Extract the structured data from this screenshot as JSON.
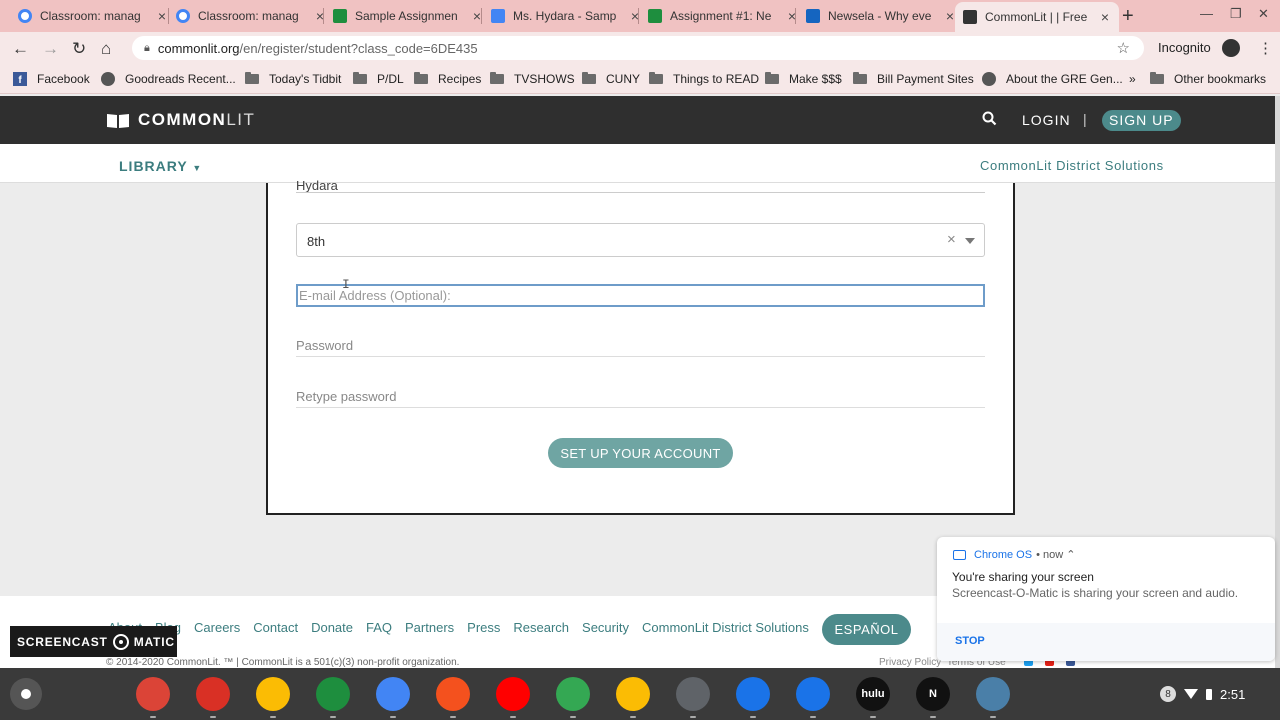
{
  "browser": {
    "tabs": [
      {
        "title": "Classroom: manag",
        "icon": "google-g-icon",
        "color": "#4285f4"
      },
      {
        "title": "Classroom: manag",
        "icon": "google-g-icon",
        "color": "#4285f4"
      },
      {
        "title": "Sample Assignmen",
        "icon": "google-classroom-icon",
        "color": "#1e8e3e"
      },
      {
        "title": "Ms. Hydara - Samp",
        "icon": "google-docs-icon",
        "color": "#4285f4"
      },
      {
        "title": "Assignment #1: Ne",
        "icon": "google-classroom-icon",
        "color": "#1e8e3e"
      },
      {
        "title": "Newsela - Why eve",
        "icon": "newsela-icon",
        "color": "#1565c0"
      },
      {
        "title": "CommonLit | | Free",
        "icon": "commonlit-book-icon",
        "color": "#333333"
      }
    ],
    "url_host": "commonlit.org",
    "url_path": "/en/register/student?class_code=6DE435",
    "incognito_label": "Incognito",
    "bookmarks": [
      {
        "label": "Facebook",
        "icon": "facebook-icon"
      },
      {
        "label": "Goodreads Recent...",
        "icon": "globe-icon"
      },
      {
        "label": "Today's Tidbit",
        "icon": "folder-icon"
      },
      {
        "label": "P/DL",
        "icon": "folder-icon"
      },
      {
        "label": "Recipes",
        "icon": "folder-icon"
      },
      {
        "label": "TVSHOWS",
        "icon": "folder-icon"
      },
      {
        "label": "CUNY",
        "icon": "folder-icon"
      },
      {
        "label": "Things to READ",
        "icon": "folder-icon"
      },
      {
        "label": "Make $$$",
        "icon": "folder-icon"
      },
      {
        "label": "Bill Payment Sites",
        "icon": "folder-icon"
      },
      {
        "label": "About the GRE Gen...",
        "icon": "globe-icon"
      }
    ],
    "bookmarks_overflow": "»",
    "other_bookmarks": "Other bookmarks"
  },
  "site": {
    "brand_common": "COMMON",
    "brand_lit": "LIT",
    "login": "LOGIN",
    "separator": "|",
    "signup": "SIGN UP",
    "library": "LIBRARY",
    "district": "CommonLit District Solutions"
  },
  "form": {
    "last_name_value": "Hydara",
    "grade_value": "8th",
    "grade_clear": "×",
    "email_placeholder": "E-mail Address (Optional):",
    "password_placeholder": "Password",
    "retype_placeholder": "Retype password",
    "submit_label": "SET UP YOUR ACCOUNT"
  },
  "footer": {
    "links": [
      "About",
      "Blog",
      "Careers",
      "Contact",
      "Donate",
      "FAQ",
      "Partners",
      "Press",
      "Research",
      "Security",
      "CommonLit District Solutions"
    ],
    "espanol": "ESPAÑOL",
    "copyright": "© 2014-2020 CommonLit. ™ | CommonLit is a 501(c)(3) non-profit organization.",
    "privacy": "Privacy Policy",
    "terms": "Terms of Use"
  },
  "screencast_badge": {
    "left": "SCREENCAST",
    "right": "MATIC"
  },
  "notification": {
    "app": "Chrome OS",
    "time": "now",
    "title": "You're sharing your screen",
    "body": "Screencast-O-Matic is sharing your screen and audio.",
    "stop": "STOP"
  },
  "shelf": {
    "apps": [
      {
        "name": "chrome-icon",
        "color": "#db4437",
        "label": ""
      },
      {
        "name": "gmail-icon",
        "color": "#d93025",
        "label": ""
      },
      {
        "name": "keep-icon",
        "color": "#fbbc04",
        "label": ""
      },
      {
        "name": "drive-icon",
        "color": "#1e8e3e",
        "label": ""
      },
      {
        "name": "docs-icon",
        "color": "#4285f4",
        "label": ""
      },
      {
        "name": "play-movies-icon",
        "color": "#f4511e",
        "label": ""
      },
      {
        "name": "youtube-icon",
        "color": "#ff0000",
        "label": ""
      },
      {
        "name": "play-store-icon",
        "color": "#34a853",
        "label": ""
      },
      {
        "name": "photos-icon",
        "color": "#fbbc04",
        "label": ""
      },
      {
        "name": "calculator-icon",
        "color": "#5f6368",
        "label": ""
      },
      {
        "name": "files-icon",
        "color": "#1a73e8",
        "label": ""
      },
      {
        "name": "messages-icon",
        "color": "#1a73e8",
        "label": ""
      },
      {
        "name": "hulu-icon",
        "color": "#111111",
        "label": "hulu"
      },
      {
        "name": "netflix-icon",
        "color": "#111111",
        "label": "N"
      },
      {
        "name": "screencast-icon",
        "color": "#4a7fa8",
        "label": ""
      }
    ],
    "notification_count": "8",
    "clock": "2:51"
  }
}
